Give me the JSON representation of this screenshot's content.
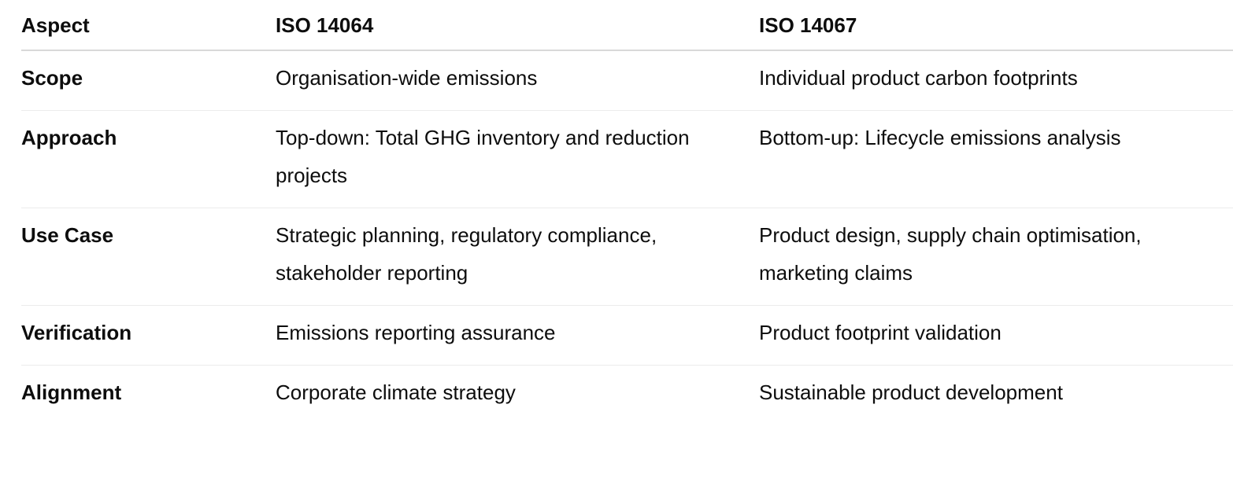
{
  "table": {
    "headers": [
      "Aspect",
      "ISO 14064",
      "ISO 14067"
    ],
    "rows": [
      [
        "Scope",
        "Organisation-wide emissions",
        "Individual product carbon footprints"
      ],
      [
        "Approach",
        "Top-down: Total GHG inventory and reduction projects",
        "Bottom-up: Lifecycle emissions analysis"
      ],
      [
        "Use Case",
        "Strategic planning, regulatory compliance, stakeholder reporting",
        "Product design, supply chain optimisation, marketing claims"
      ],
      [
        "Verification",
        "Emissions reporting assurance",
        "Product footprint validation"
      ],
      [
        "Alignment",
        "Corporate climate strategy",
        "Sustainable product development"
      ]
    ]
  }
}
